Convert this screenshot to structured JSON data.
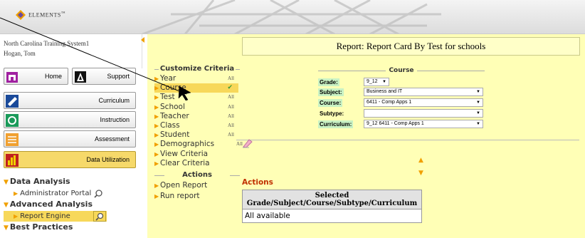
{
  "app": {
    "logo_text": "ELEMENTS",
    "logo_mark": "™",
    "accent_color": "#f0a000",
    "panel_color": "#ffffb6"
  },
  "user": {
    "system": "North Carolina Training System1",
    "name": "Hogan, Tom"
  },
  "nav": {
    "home_label": "Home",
    "support_label": "Support",
    "buttons": [
      {
        "label": "Curriculum",
        "icon": "curriculum-icon"
      },
      {
        "label": "Instruction",
        "icon": "instruction-icon"
      },
      {
        "label": "Assessment",
        "icon": "assessment-icon"
      },
      {
        "label": "Data Utilization",
        "icon": "data-utilization-icon",
        "active": true
      }
    ]
  },
  "sidebar_sections": {
    "data_analysis": "Data Analysis",
    "admin_portal": "Administrator Portal",
    "advanced_analysis": "Advanced Analysis",
    "report_engine": "Report Engine",
    "best_practices": "Best Practices"
  },
  "report": {
    "title": "Report: Report Card By Test for schools"
  },
  "criteria": {
    "heading": "Customize Criteria",
    "items": [
      {
        "label": "Year",
        "value": "All"
      },
      {
        "label": "Course",
        "value": "✔",
        "selected": true
      },
      {
        "label": "Test",
        "value": "All"
      },
      {
        "label": "School",
        "value": "All"
      },
      {
        "label": "Teacher",
        "value": "All"
      },
      {
        "label": "Class",
        "value": "All"
      },
      {
        "label": "Student",
        "value": "All"
      },
      {
        "label": "Demographics",
        "value": "All"
      },
      {
        "label": "View Criteria",
        "value": ""
      },
      {
        "label": "Clear Criteria",
        "value": ""
      }
    ],
    "actions_heading": "Actions",
    "actions": [
      "Open Report",
      "Run report"
    ]
  },
  "course": {
    "heading": "Course",
    "grade_label": "Grade:",
    "grade_value": "9_12",
    "subject_label": "Subject:",
    "subject_value": "Business and IT",
    "course_label": "Course:",
    "course_value": "6411 - Comp Apps 1",
    "subtype_label": "Subtype:",
    "subtype_value": "",
    "curriculum_label": "Curriculum:",
    "curriculum_value": "9_12 6411 - Comp Apps 1"
  },
  "actions_panel": {
    "label": "Actions",
    "table_header_line1": "Selected",
    "table_header_line2": "Grade/Subject/Course/Subtype/Curriculum",
    "table_value": "All available"
  }
}
